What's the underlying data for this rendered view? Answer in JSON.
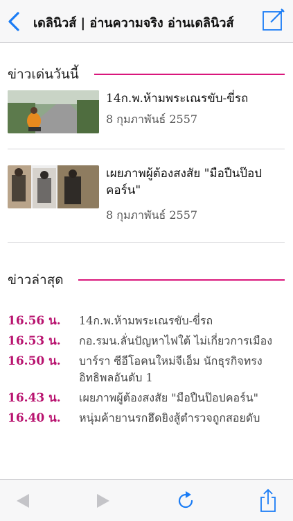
{
  "navbar": {
    "title": "เดลินิวส์ | อ่านความจริง อ่านเดลินิวส์",
    "back_icon": "chevron-left-icon",
    "compose_icon": "compose-icon"
  },
  "featured": {
    "heading": "ข่าวเด่นวันนี้",
    "stories": [
      {
        "title": "14ก.พ.ห้ามพระเณรขับ-ขี่รถ",
        "date": "8 กุมภาพันธ์ 2557"
      },
      {
        "title": "เผยภาพผู้ต้องสงสัย \"มือปืนป๊อปคอร์น\"",
        "date": "8 กุมภาพันธ์ 2557"
      }
    ]
  },
  "latest": {
    "heading": "ข่าวล่าสุด",
    "items": [
      {
        "time": "16.56 น.",
        "headline": "14ก.พ.ห้ามพระเณรขับ-ขี่รถ"
      },
      {
        "time": "16.53 น.",
        "headline": "กอ.รมน.ลั่นปัญหาไฟใต้ ไม่เกี่ยวการเมือง"
      },
      {
        "time": "16.50 น.",
        "headline": "บาร์รา ซีอีโอคนใหม่จีเอ็ม นักธุรกิจทรงอิทธิพลอันดับ 1"
      },
      {
        "time": "16.43 น.",
        "headline": "เผยภาพผู้ต้องสงสัย \"มือปืนป๊อปคอร์น\""
      },
      {
        "time": "16.40 น.",
        "headline": "หนุ่มค้ายานรกฮึดยิงสู้ตำรวจถูกสอยดับ"
      }
    ]
  },
  "toolbar": {
    "back_icon": "arrow-left-icon",
    "forward_icon": "arrow-right-icon",
    "reload_icon": "reload-icon",
    "share_icon": "share-icon"
  },
  "colors": {
    "accent": "#d9177c",
    "time": "#b8136f",
    "ios_blue": "#1a7cf5"
  }
}
